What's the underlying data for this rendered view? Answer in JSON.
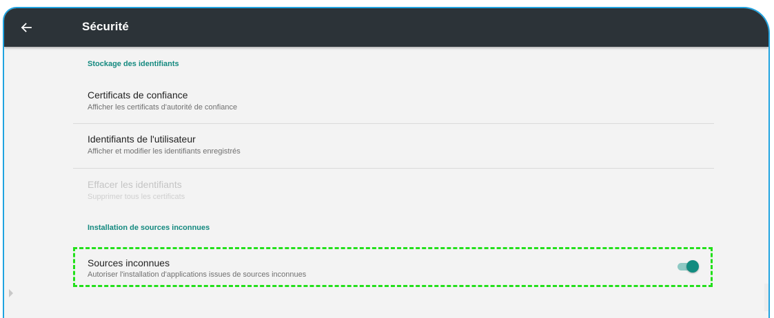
{
  "app_bar": {
    "back_icon": "arrow-left-icon",
    "title": "Sécurité"
  },
  "sections": [
    {
      "header": "Stockage des identifiants",
      "items": [
        {
          "title": "Certificats de confiance",
          "summary": "Afficher les certificats d'autorité de confiance",
          "enabled": true
        },
        {
          "title": "Identifiants de l'utilisateur",
          "summary": "Afficher et modifier les identifiants enregistrés",
          "enabled": true
        },
        {
          "title": "Effacer les identifiants",
          "summary": "Supprimer tous les certificats",
          "enabled": false
        }
      ]
    },
    {
      "header": "Installation de sources inconnues",
      "items": [
        {
          "title": "Sources inconnues",
          "summary": "Autoriser l'installation d'applications issues de sources inconnues",
          "toggle_on": true
        }
      ]
    }
  ],
  "colors": {
    "app_bar": "#2c3338",
    "accent": "#14897f",
    "highlight": "#22e01a",
    "device_border": "#1fa3e0"
  }
}
